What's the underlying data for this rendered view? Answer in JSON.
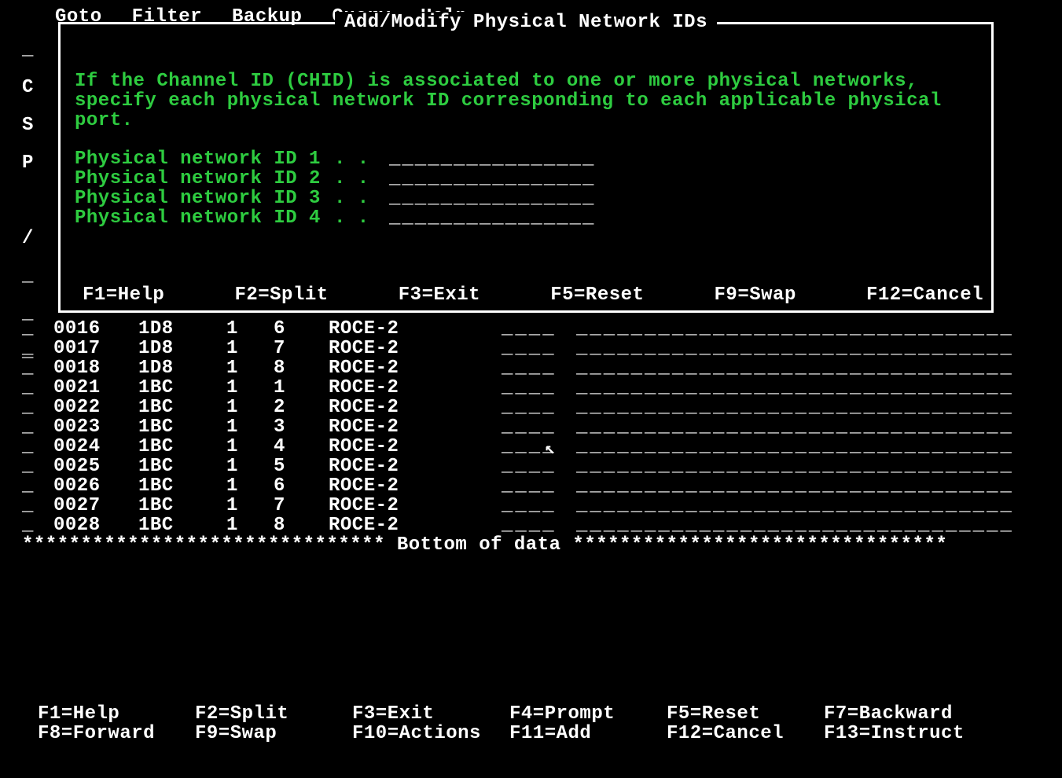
{
  "menu": {
    "items": [
      "Goto",
      "Filter",
      "Backup",
      "Query",
      "Help"
    ]
  },
  "leftcol": [
    "_",
    "C",
    "S",
    "P",
    "",
    "/",
    "_",
    "_",
    "_"
  ],
  "dialog": {
    "title": "Add/Modify Physical Network IDs",
    "instruction": "If the Channel ID (CHID) is associated to one or more physical networks, specify each physical network ID corresponding to each applicable physical port.",
    "fields": [
      {
        "label": "Physical network ID 1",
        "dots": ". .",
        "value": "________________"
      },
      {
        "label": "Physical network ID 2",
        "dots": ". .",
        "value": "________________"
      },
      {
        "label": "Physical network ID 3",
        "dots": ". .",
        "value": "________________"
      },
      {
        "label": "Physical network ID 4",
        "dots": ". .",
        "value": "________________"
      }
    ],
    "fkeys": [
      "F1=Help",
      "F2=Split",
      "F3=Exit",
      "F5=Reset",
      "F9=Swap",
      "F12=Cancel"
    ]
  },
  "grid": {
    "rows": [
      {
        "sel": "_",
        "id": "0016",
        "chp": "1D8",
        "a": "1",
        "b": "6",
        "type": "ROCE-2",
        "f1": "____",
        "f2": "________________________________"
      },
      {
        "sel": "_",
        "id": "0017",
        "chp": "1D8",
        "a": "1",
        "b": "7",
        "type": "ROCE-2",
        "f1": "____",
        "f2": "________________________________"
      },
      {
        "sel": "_",
        "id": "0018",
        "chp": "1D8",
        "a": "1",
        "b": "8",
        "type": "ROCE-2",
        "f1": "____",
        "f2": "________________________________"
      },
      {
        "sel": "_",
        "id": "0021",
        "chp": "1BC",
        "a": "1",
        "b": "1",
        "type": "ROCE-2",
        "f1": "____",
        "f2": "________________________________"
      },
      {
        "sel": "_",
        "id": "0022",
        "chp": "1BC",
        "a": "1",
        "b": "2",
        "type": "ROCE-2",
        "f1": "____",
        "f2": "________________________________"
      },
      {
        "sel": "_",
        "id": "0023",
        "chp": "1BC",
        "a": "1",
        "b": "3",
        "type": "ROCE-2",
        "f1": "____",
        "f2": "________________________________"
      },
      {
        "sel": "_",
        "id": "0024",
        "chp": "1BC",
        "a": "1",
        "b": "4",
        "type": "ROCE-2",
        "f1": "____",
        "f2": "________________________________"
      },
      {
        "sel": "_",
        "id": "0025",
        "chp": "1BC",
        "a": "1",
        "b": "5",
        "type": "ROCE-2",
        "f1": "____",
        "f2": "________________________________"
      },
      {
        "sel": "_",
        "id": "0026",
        "chp": "1BC",
        "a": "1",
        "b": "6",
        "type": "ROCE-2",
        "f1": "____",
        "f2": "________________________________"
      },
      {
        "sel": "_",
        "id": "0027",
        "chp": "1BC",
        "a": "1",
        "b": "7",
        "type": "ROCE-2",
        "f1": "____",
        "f2": "________________________________"
      },
      {
        "sel": "_",
        "id": "0028",
        "chp": "1BC",
        "a": "1",
        "b": "8",
        "type": "ROCE-2",
        "f1": "____",
        "f2": "________________________________"
      }
    ],
    "bottom_marker": "******************************* Bottom of data ********************************"
  },
  "bottom_fkeys": {
    "row1": [
      "F1=Help",
      "F2=Split",
      "F3=Exit",
      "F4=Prompt",
      "F5=Reset",
      "F7=Backward"
    ],
    "row2": [
      "F8=Forward",
      "F9=Swap",
      "F10=Actions",
      "F11=Add",
      "F12=Cancel",
      "F13=Instruct"
    ]
  }
}
